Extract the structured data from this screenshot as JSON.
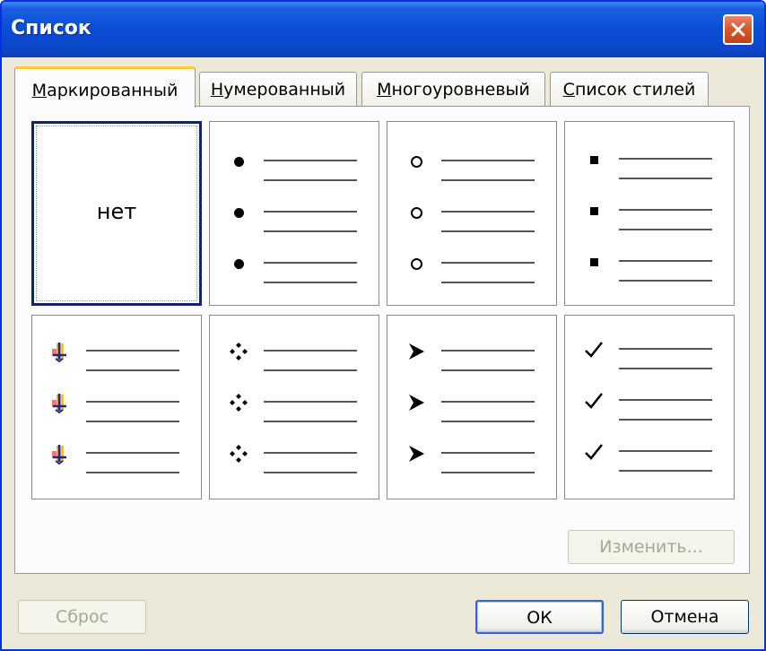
{
  "window": {
    "title": "Список"
  },
  "tabs": [
    {
      "label": "Маркированный",
      "underline": "М",
      "rest": "аркированный",
      "active": true
    },
    {
      "label": "Нумерованный",
      "underline": "Н",
      "rest": "умерованный",
      "active": false
    },
    {
      "label": "Многоуровневый",
      "underline": "М",
      "rest": "ногоуровневый",
      "active": false
    },
    {
      "label": "Список стилей",
      "underline": "С",
      "rest": "писок стилей",
      "active": false
    }
  ],
  "gallery": {
    "tiles": [
      {
        "id": "none",
        "label": "нет",
        "bullet": "none",
        "selected": true
      },
      {
        "id": "dot",
        "bullet": "filled-circle-icon"
      },
      {
        "id": "circle",
        "bullet": "hollow-circle-icon"
      },
      {
        "id": "square",
        "bullet": "filled-square-icon"
      },
      {
        "id": "picture",
        "bullet": "picture-bullet-icon"
      },
      {
        "id": "diamond",
        "bullet": "four-diamond-icon"
      },
      {
        "id": "arrow",
        "bullet": "arrowhead-icon"
      },
      {
        "id": "check",
        "bullet": "checkmark-icon"
      }
    ]
  },
  "buttons": {
    "modify": "Изменить...",
    "reset": "Сброс",
    "ok": "ОК",
    "cancel": "Отмена"
  },
  "colors": {
    "titlebar": "#0a4cd6",
    "dialog_bg": "#ece9d8",
    "close_button": "#d65a2d",
    "active_tab_accent": "#ffc83c"
  }
}
